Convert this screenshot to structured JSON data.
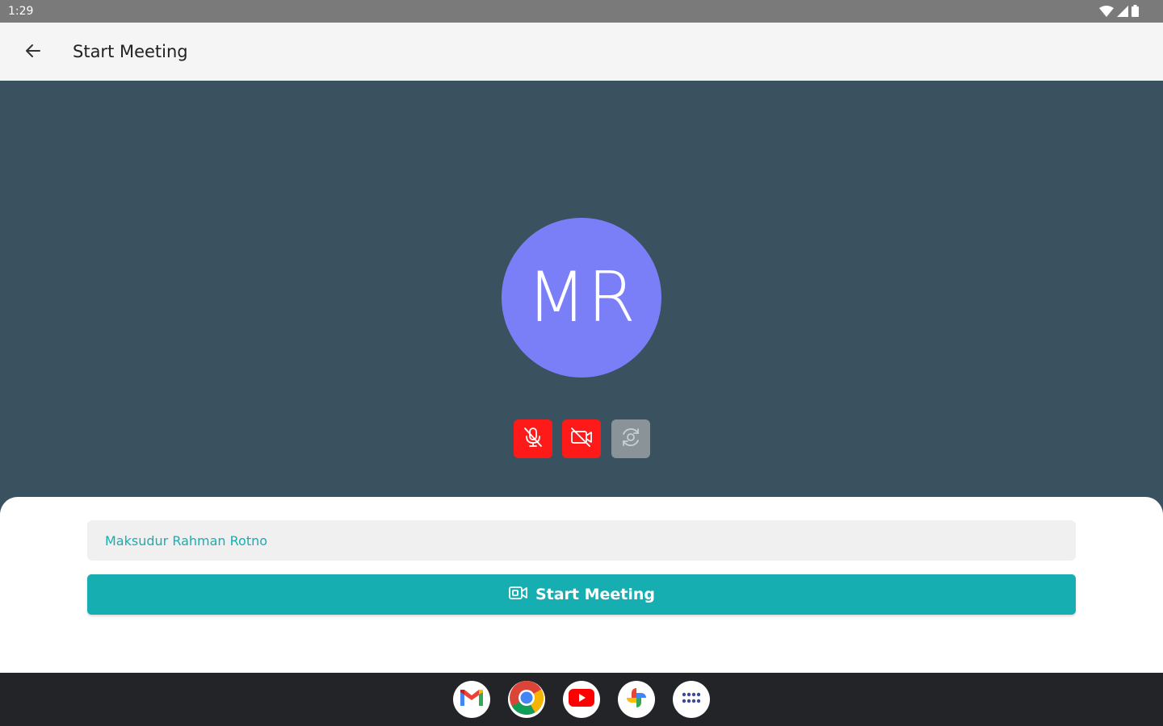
{
  "status_bar": {
    "time": "1:29",
    "icons": [
      "wifi-icon",
      "signal-icon",
      "battery-icon"
    ]
  },
  "app_bar": {
    "back_icon": "arrow-left-icon",
    "title": "Start Meeting"
  },
  "preview": {
    "avatar_initials": "MR",
    "avatar_color": "#7b7ff7",
    "background_color": "#3a5160",
    "controls": [
      {
        "name": "mic-off",
        "icon": "mic-off-icon",
        "state": "off",
        "color": "#ff1a1a"
      },
      {
        "name": "camera-off",
        "icon": "video-off-icon",
        "state": "off",
        "color": "#ff1a1a"
      },
      {
        "name": "switch-camera",
        "icon": "flip-camera-icon",
        "state": "disabled",
        "color": "#8a9498"
      }
    ]
  },
  "form": {
    "name_value": "Maksudur Rahman Rotno",
    "start_button_icon": "video-camera-icon",
    "start_button_label": "Start Meeting",
    "accent_color": "#17aeb2"
  },
  "taskbar": {
    "apps": [
      "gmail-icon",
      "chrome-icon",
      "youtube-icon",
      "photos-icon",
      "app-launcher-icon"
    ]
  }
}
